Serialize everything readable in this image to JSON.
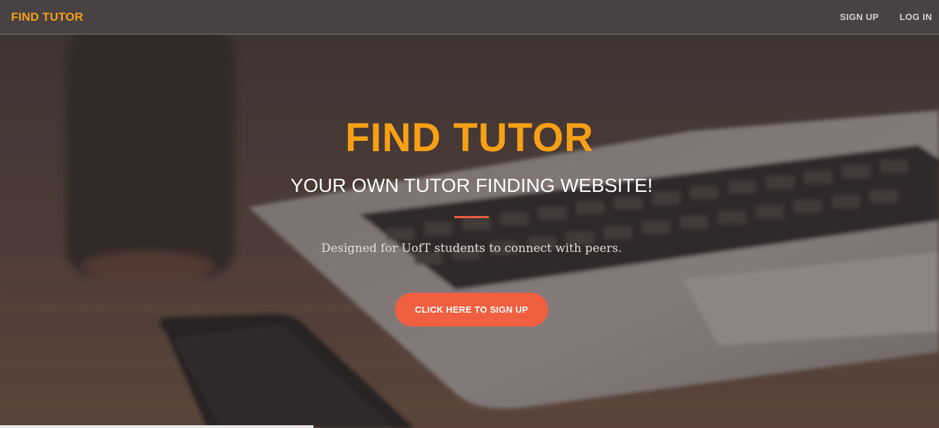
{
  "navbar": {
    "brand": "FIND TUTOR",
    "links": [
      {
        "label": "SIGN UP"
      },
      {
        "label": "LOG IN"
      }
    ]
  },
  "hero": {
    "title": "FIND TUTOR",
    "subtitle": "YOUR OWN TUTOR FINDING WEBSITE!",
    "text": "Designed for UofT students to connect with peers.",
    "cta_label": "CLICK HERE TO SIGN UP"
  },
  "colors": {
    "brand": "#f6a019",
    "accent": "#f05f40",
    "navbar": "#484443"
  },
  "background": {
    "icons": [
      "laptop-icon",
      "phone-icon",
      "cup-icon"
    ]
  }
}
